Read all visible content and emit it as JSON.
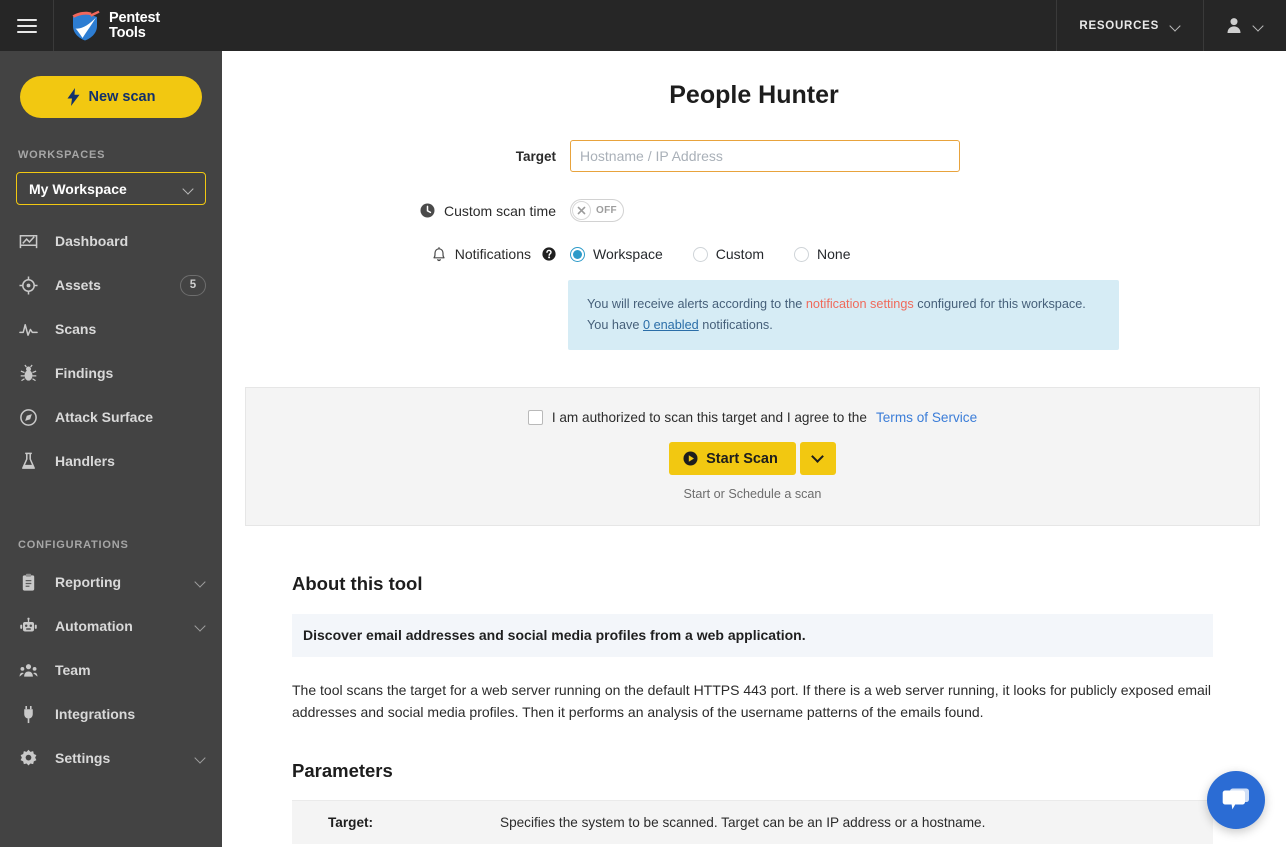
{
  "header": {
    "menu_icon": "hamburger-icon",
    "brand_line1": "Pentest",
    "brand_line2": "Tools",
    "resources_label": "RESOURCES",
    "account_icon": "person-icon"
  },
  "sidebar": {
    "new_scan_label": "New scan",
    "workspaces_heading": "WORKSPACES",
    "workspace_selected": "My Workspace",
    "nav_items": [
      {
        "label": "Dashboard",
        "icon": "dashboard-icon",
        "badge": "",
        "caret": false
      },
      {
        "label": "Assets",
        "icon": "assets-target-icon",
        "badge": "5",
        "caret": false
      },
      {
        "label": "Scans",
        "icon": "scans-pulse-icon",
        "badge": "",
        "caret": false
      },
      {
        "label": "Findings",
        "icon": "findings-bug-icon",
        "badge": "",
        "caret": false
      },
      {
        "label": "Attack Surface",
        "icon": "attack-surface-compass-icon",
        "badge": "",
        "caret": false
      },
      {
        "label": "Handlers",
        "icon": "handlers-flask-icon",
        "badge": "",
        "caret": false
      }
    ],
    "configurations_heading": "CONFIGURATIONS",
    "config_items": [
      {
        "label": "Reporting",
        "icon": "reporting-clipboard-icon",
        "badge": "",
        "caret": true
      },
      {
        "label": "Automation",
        "icon": "automation-robot-icon",
        "badge": "",
        "caret": true
      },
      {
        "label": "Team",
        "icon": "team-people-icon",
        "badge": "",
        "caret": false
      },
      {
        "label": "Integrations",
        "icon": "integrations-plug-icon",
        "badge": "",
        "caret": false
      },
      {
        "label": "Settings",
        "icon": "settings-gear-icon",
        "badge": "",
        "caret": true
      }
    ]
  },
  "main": {
    "page_title": "People Hunter",
    "target_label": "Target",
    "target_value": "",
    "target_placeholder": "Hostname / IP Address",
    "custom_scan_time_label": "Custom scan time",
    "toggle_state_label": "OFF",
    "notifications_label": "Notifications",
    "notification_options": [
      {
        "label": "Workspace",
        "checked": true
      },
      {
        "label": "Custom",
        "checked": false
      },
      {
        "label": "None",
        "checked": false
      }
    ],
    "alert": {
      "text_1": "You will receive alerts according to the ",
      "link_settings": "notification settings",
      "text_2": " configured for this workspace.",
      "text_3": "You have ",
      "link_enabled": "0 enabled",
      "text_4": " notifications."
    },
    "agree_text": "I am authorized to scan this target and I agree to the ",
    "terms_link": "Terms of Service",
    "start_scan_label": "Start Scan",
    "start_hint": "Start or Schedule a scan",
    "about_heading": "About this tool",
    "tool_summary": "Discover email addresses and social media profiles from a web application.",
    "tool_description": "The tool scans the target for a web server running on the default HTTPS 443 port. If there is a web server running, it looks for publicly exposed email addresses and social media profiles. Then it performs an analysis of the username patterns of the emails found.",
    "parameters_heading": "Parameters",
    "parameters": [
      {
        "key": "Target:",
        "value": "Specifies the system to be scanned. Target can be an IP address or a hostname."
      }
    ]
  },
  "chat": {
    "icon": "chat-bubbles-icon"
  },
  "colors": {
    "brand_yellow": "#F2C811",
    "header_dark": "#262626",
    "sidebar_gray": "#434343",
    "accent_blue": "#2e9bc9",
    "alert_bg": "#D6ECF5",
    "salmon": "#F06A5B",
    "chat_blue": "#2B6CD4",
    "focus_orange": "#E8A33D"
  }
}
